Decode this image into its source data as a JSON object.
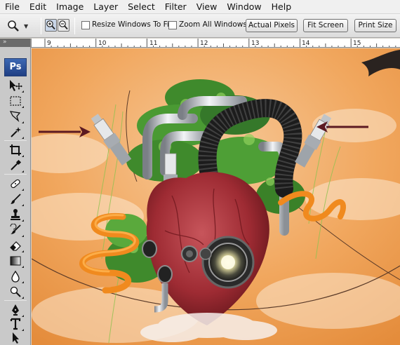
{
  "menu": [
    "File",
    "Edit",
    "Image",
    "Layer",
    "Select",
    "Filter",
    "View",
    "Window",
    "Help"
  ],
  "options": {
    "resize_windows_label": "Resize Windows To Fit",
    "zoom_all_label": "Zoom All Windows",
    "resize_windows_checked": false,
    "zoom_all_checked": false,
    "actual_pixels": "Actual Pixels",
    "fit_screen": "Fit Screen",
    "print_size": "Print Size"
  },
  "toolbox": {
    "logo": "Ps",
    "tools": [
      "move-tool",
      "marquee-tool",
      "lasso-tool",
      "magic-wand-tool",
      "crop-tool",
      "eyedropper-tool",
      "healing-brush-tool",
      "brush-tool",
      "clone-stamp-tool",
      "history-brush-tool",
      "eraser-tool",
      "gradient-tool",
      "blur-tool",
      "dodge-tool",
      "pen-tool",
      "type-tool",
      "path-selection-tool"
    ]
  },
  "ruler": {
    "labels": [
      "9",
      "10",
      "11",
      "12",
      "13",
      "14",
      "15"
    ]
  },
  "colors": {
    "sky": "#f0a85e",
    "arrow": "#5c1a22",
    "heart": "#9c2a32",
    "foliage": "#3f8a2c",
    "spring": "#f08a1e",
    "menubar": "#f0f0f0"
  }
}
